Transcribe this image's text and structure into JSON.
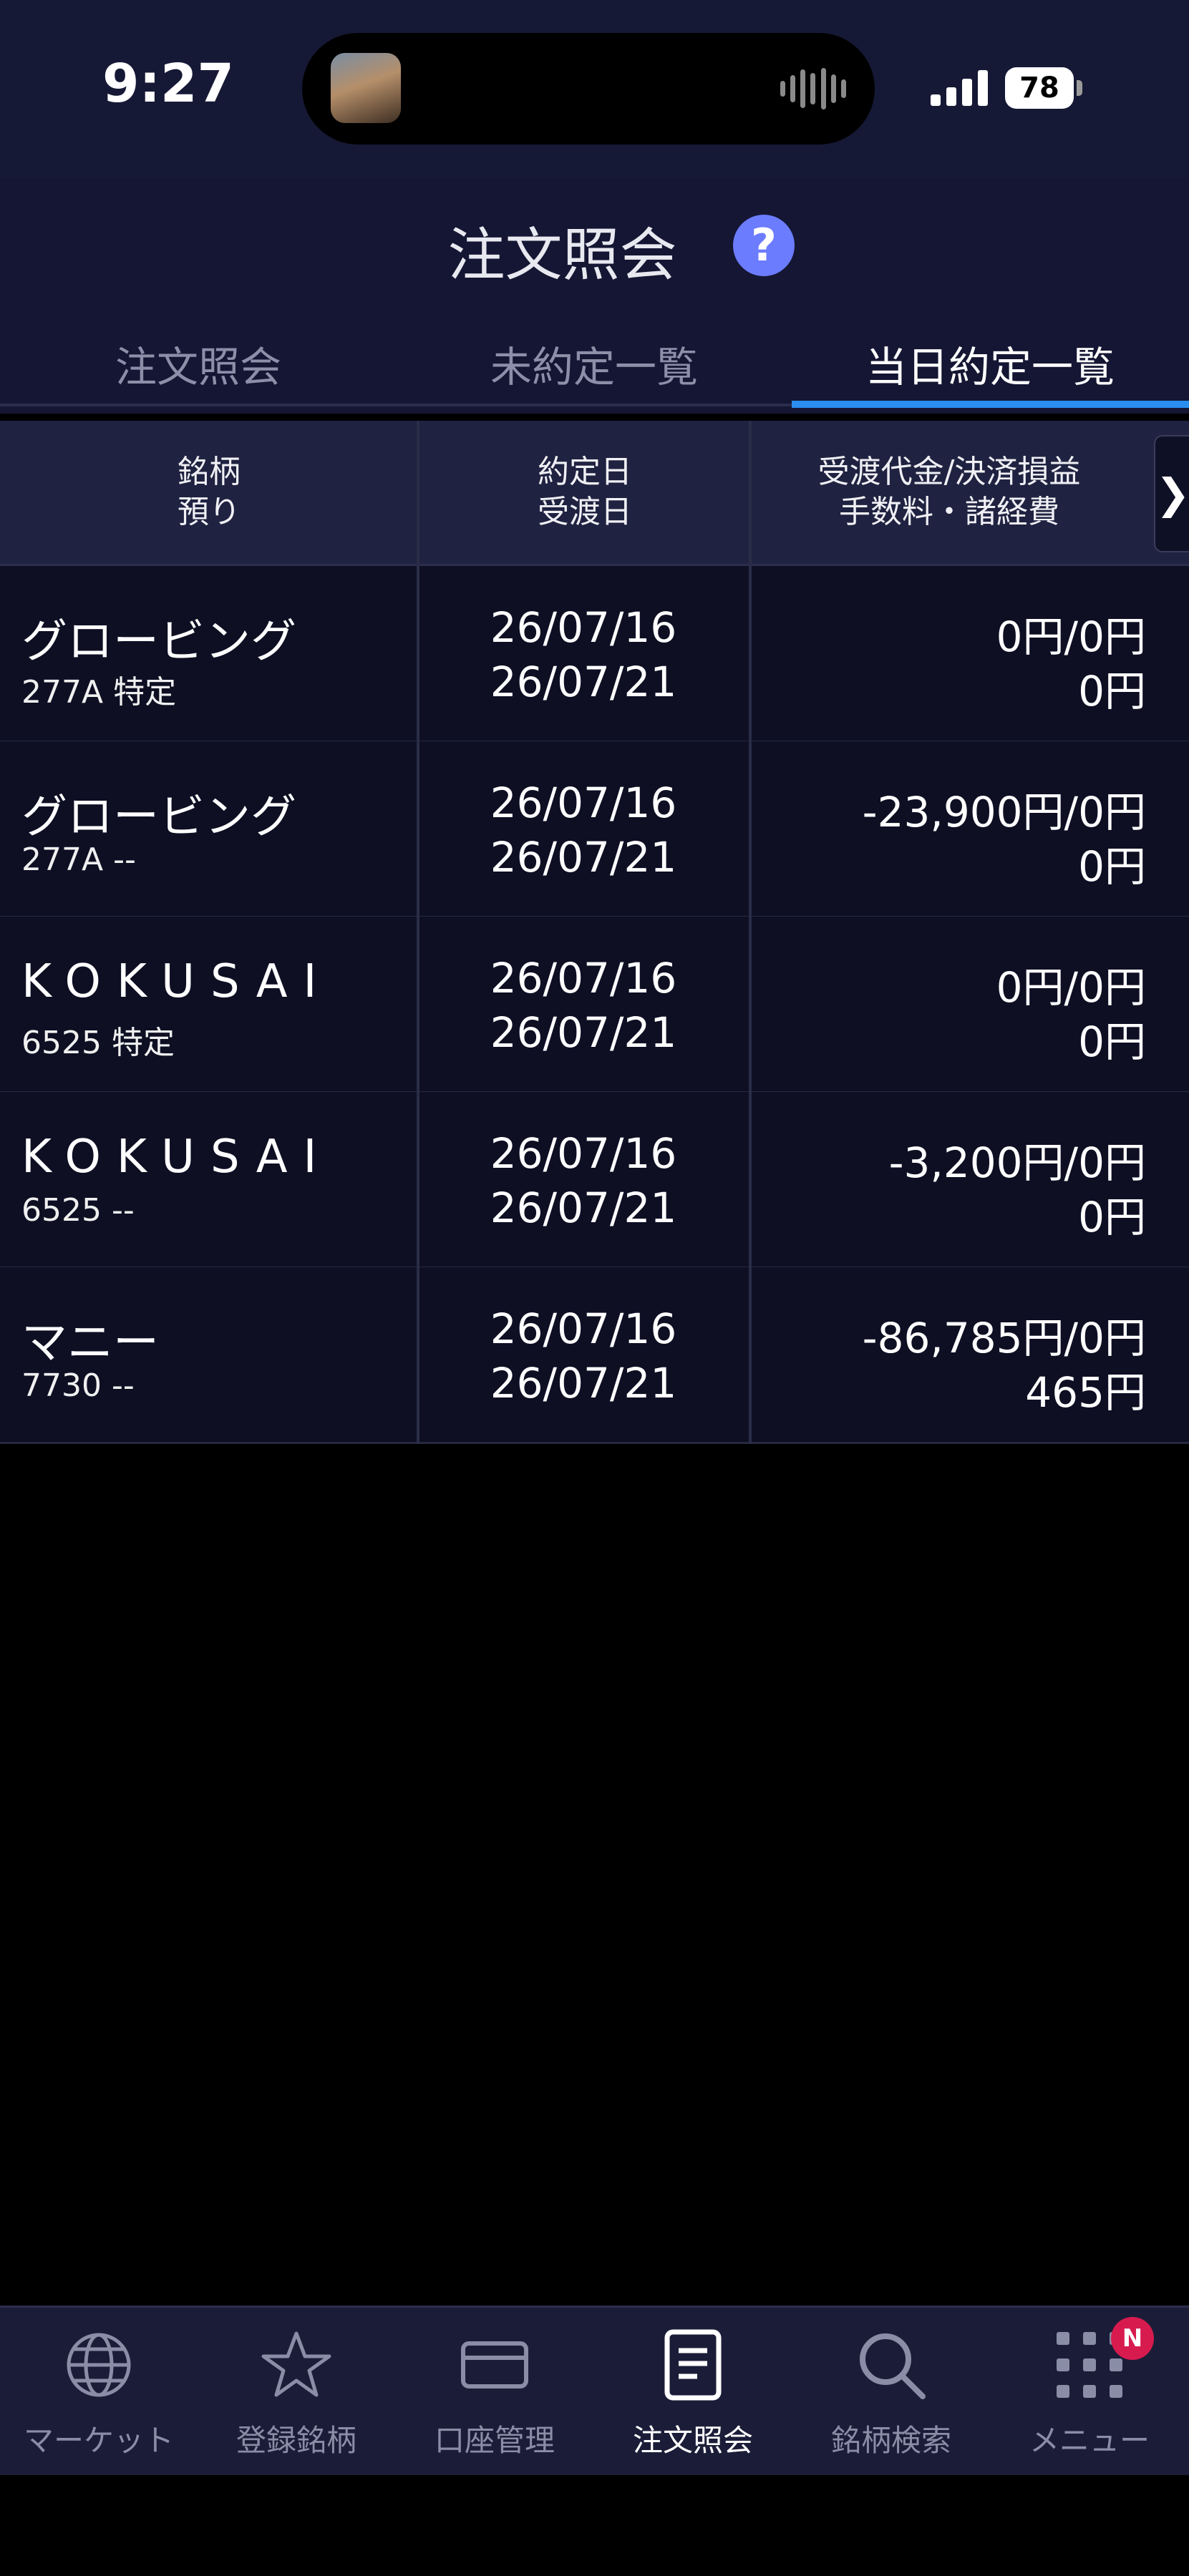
{
  "status_bar": {
    "time": "9:27",
    "battery": "78"
  },
  "header": {
    "title": "注文照会",
    "help_icon": "question-circle-icon"
  },
  "tabs": [
    {
      "label": "注文照会",
      "active": false
    },
    {
      "label": "未約定一覧",
      "active": false
    },
    {
      "label": "当日約定一覧",
      "active": true
    }
  ],
  "table": {
    "headers": [
      {
        "line1": "銘柄",
        "line2": "預り"
      },
      {
        "line1": "約定日",
        "line2": "受渡日"
      },
      {
        "line1": "受渡代金/決済損益",
        "line2": "手数料・諸経費"
      }
    ],
    "scroll_icon": "chevron-right-icon",
    "rows": [
      {
        "name": "グロービング",
        "code": "277A 特定",
        "trade_date": "26/07/16",
        "settle_date": "26/07/21",
        "amount": "0円/0円",
        "fee": "0円"
      },
      {
        "name": "グロービング",
        "code": "277A --",
        "trade_date": "26/07/16",
        "settle_date": "26/07/21",
        "amount": "-23,900円/0円",
        "fee": "0円"
      },
      {
        "name": "KOKUSAI",
        "code": "6525 特定",
        "trade_date": "26/07/16",
        "settle_date": "26/07/21",
        "amount": "0円/0円",
        "fee": "0円"
      },
      {
        "name": "KOKUSAI",
        "code": "6525 --",
        "trade_date": "26/07/16",
        "settle_date": "26/07/21",
        "amount": "-3,200円/0円",
        "fee": "0円"
      },
      {
        "name": "マニー",
        "code": "7730 --",
        "trade_date": "26/07/16",
        "settle_date": "26/07/21",
        "amount": "-86,785円/0円",
        "fee": "465円"
      }
    ]
  },
  "bottom_nav": [
    {
      "label": "マーケット",
      "icon": "globe-icon",
      "active": false
    },
    {
      "label": "登録銘柄",
      "icon": "star-icon",
      "active": false
    },
    {
      "label": "口座管理",
      "icon": "card-icon",
      "active": false
    },
    {
      "label": "注文照会",
      "icon": "document-icon",
      "active": true
    },
    {
      "label": "銘柄検索",
      "icon": "search-icon",
      "active": false
    },
    {
      "label": "メニュー",
      "icon": "grid-icon",
      "active": false,
      "badge": "N"
    }
  ],
  "colors": {
    "accent": "#2a8ef0",
    "help": "#6b7cff",
    "badge": "#d81b4f",
    "header_bg": "#141633",
    "row_bg": "#0e0f23"
  }
}
